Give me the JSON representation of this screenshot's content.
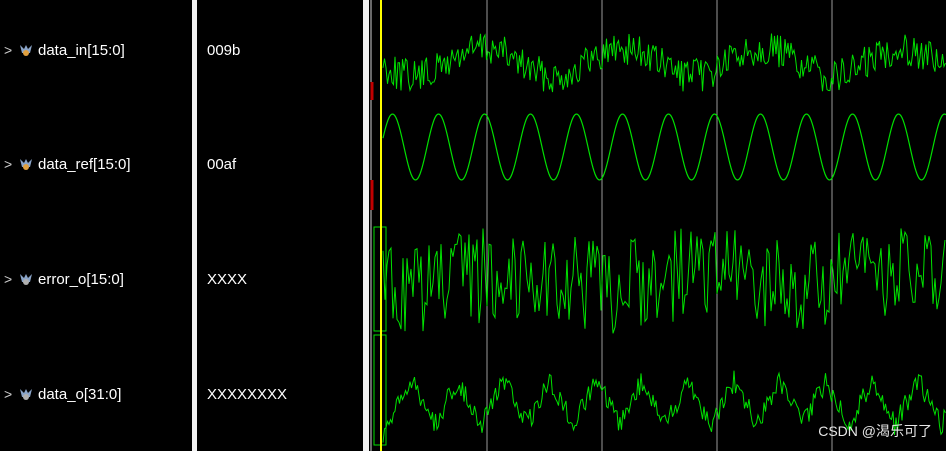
{
  "signals": [
    {
      "name": "data_in[15:0]",
      "value": "009b",
      "icon": "bus-signal-icon"
    },
    {
      "name": "data_ref[15:0]",
      "value": "00af",
      "icon": "bus-signal-icon"
    },
    {
      "name": "error_o[15:0]",
      "value": "XXXX",
      "icon": "bus-signal-icon"
    },
    {
      "name": "data_o[31:0]",
      "value": "XXXXXXXX",
      "icon": "bus-signal-icon"
    }
  ],
  "watermark": "CSDN @渴乐可了",
  "colors": {
    "wave": "#00e000",
    "cursor": "#ffff00",
    "grid": "#9a9a9a",
    "marker": "#c00000",
    "undefined": "#e02020"
  }
}
